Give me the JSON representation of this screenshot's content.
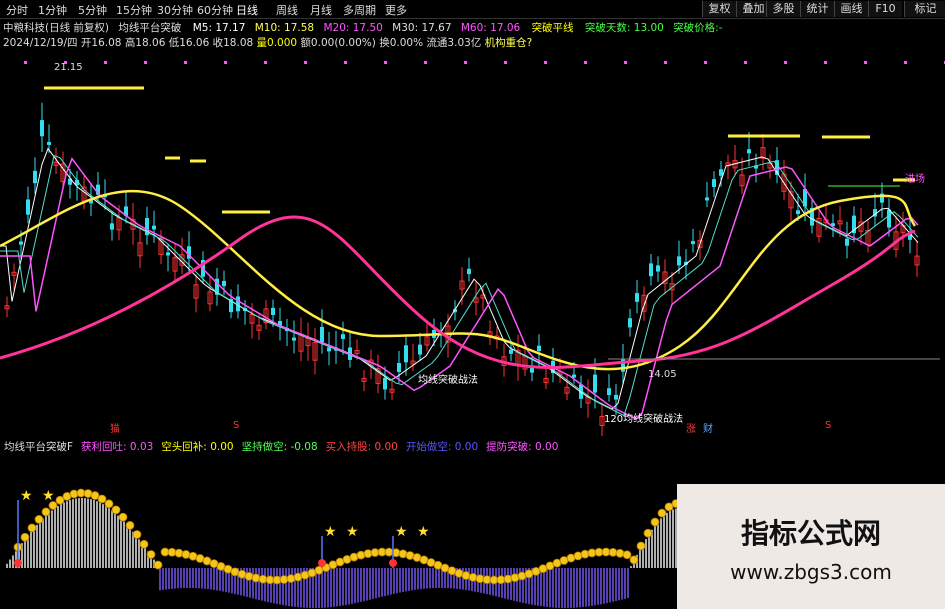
{
  "tabs": [
    "分时",
    "1分钟",
    "5分钟",
    "15分钟",
    "30分钟",
    "60分钟",
    "日线",
    "周线",
    "月线",
    "多周期",
    "更多"
  ],
  "active_tab": "日线",
  "right_buttons": [
    "复权",
    "叠加",
    "多股",
    "统计",
    "画线",
    "F10",
    "标记"
  ],
  "header": {
    "stock": "中粮科技(日线 前复权)",
    "indicator": "均线平台突破",
    "ma5": "M5: 17.17",
    "ma10": "M10: 17.58",
    "ma20": "M20: 17.50",
    "ma30": "M30: 17.67",
    "ma60": "M60: 17.06",
    "signal_line": "突破平线",
    "break_days": "突破天数: 13.00",
    "break_price": "突破价格:-"
  },
  "info_line": {
    "date": "2024/12/19/四",
    "open": "开16.08",
    "high": "高18.06",
    "low": "低16.06",
    "close": "收18.08",
    "volume": "量0.000",
    "change": "额0.00(0.00%)",
    "turnover": "换0.00%",
    "float": "流通3.03亿",
    "concept": "机构重仓?"
  },
  "annotations": {
    "high_price": "21.15",
    "low_price": "14.05",
    "method1": "均线突破战法",
    "method2": "120均线突破战法",
    "buy1": "猫",
    "buy2": "涨",
    "buy3": "S",
    "buy4": "S",
    "buy5": "财",
    "right_tag": "进场"
  },
  "indicator_bar": {
    "name": "均线平台突破F",
    "items": [
      {
        "label": "获利回吐: 0.03",
        "color": "#ff55ff"
      },
      {
        "label": "空头回补: 0.00",
        "color": "#ffff00"
      },
      {
        "label": "坚持做空: -0.08",
        "color": "#55ff55"
      },
      {
        "label": "买入持股: 0.00",
        "color": "#ff4444"
      },
      {
        "label": "开始做空: 0.00",
        "color": "#5555ff"
      },
      {
        "label": "提防突破: 0.00",
        "color": "#ff55ff"
      }
    ]
  },
  "watermark": {
    "title": "指标公式网",
    "url": "www.zbgs3.com"
  },
  "colors": {
    "up": "#ff3333",
    "down": "#33ddee",
    "ma5": "#ffffff",
    "ma10": "#ffff55",
    "ma20": "#ff55ff",
    "ma60": "#ff3399"
  }
}
